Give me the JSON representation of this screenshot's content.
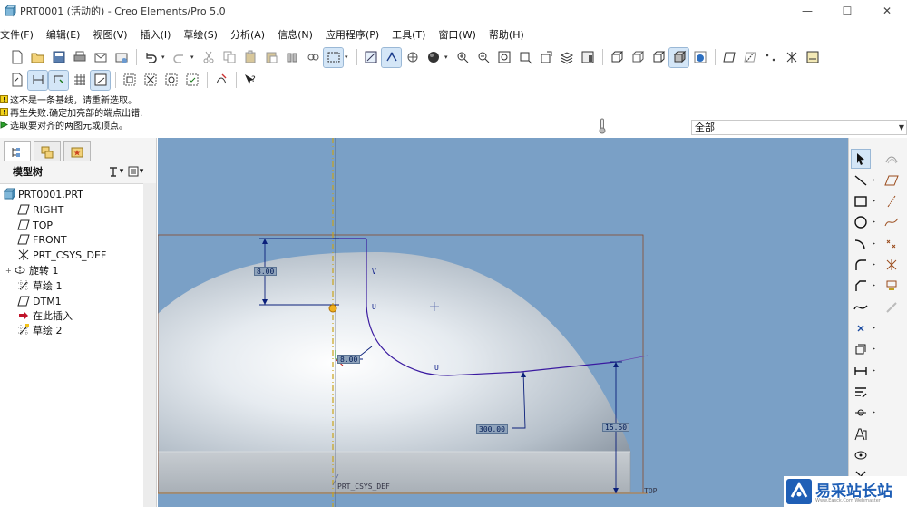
{
  "window": {
    "title": "PRT0001 (活动的) - Creo Elements/Pro 5.0",
    "controls": [
      "—",
      "☐",
      "✕"
    ]
  },
  "menu": {
    "items": [
      "文件(F)",
      "编辑(E)",
      "视图(V)",
      "插入(I)",
      "草绘(S)",
      "分析(A)",
      "信息(N)",
      "应用程序(P)",
      "工具(T)",
      "窗口(W)",
      "帮助(H)"
    ]
  },
  "messages": [
    {
      "icon": "warning-icon",
      "text": "这不是一条基线，请重新选取。"
    },
    {
      "icon": "warning-icon",
      "text": "再生失败.确定加亮部的端点出错."
    },
    {
      "icon": "prompt-arrow-icon",
      "text": "选取要对齐的两图元或顶点。"
    }
  ],
  "filter": {
    "selected": "全部"
  },
  "model_tree": {
    "header": "模型树",
    "items": [
      {
        "label": "PRT0001.PRT",
        "icon": "part-icon",
        "level": 0
      },
      {
        "label": "RIGHT",
        "icon": "datum-plane-icon",
        "level": 1
      },
      {
        "label": "TOP",
        "icon": "datum-plane-icon",
        "level": 1
      },
      {
        "label": "FRONT",
        "icon": "datum-plane-icon",
        "level": 1
      },
      {
        "label": "PRT_CSYS_DEF",
        "icon": "csys-icon",
        "level": 1
      },
      {
        "label": "旋转 1",
        "icon": "revolve-icon",
        "level": 1,
        "expandable": true
      },
      {
        "label": "草绘 1",
        "icon": "sketch-icon",
        "level": 1
      },
      {
        "label": "DTM1",
        "icon": "datum-plane-icon",
        "level": 1
      },
      {
        "label": "在此插入",
        "icon": "insert-here-icon",
        "level": 1
      },
      {
        "label": "草绘 2",
        "icon": "sketch-active-icon",
        "level": 1
      }
    ]
  },
  "sketch": {
    "dimensions": {
      "vertical_offset": "8.00",
      "fillet_radius": "8.00",
      "horizontal": "300.00",
      "height": "15.50"
    },
    "constraint_labels": {
      "v": "V",
      "u1": "U",
      "u2": "U"
    },
    "csys_label": "PRT_CSYS_DEF",
    "top_label": "TOP"
  },
  "watermark": {
    "text": "易采站长站",
    "sub": "Www.Easck.Com  Webmaster"
  },
  "colors": {
    "canvas_bg": "#7aa0c6",
    "sketch_line": "#2a2ab0",
    "dimension": "#0a1f7a",
    "datum": "#b08000"
  }
}
